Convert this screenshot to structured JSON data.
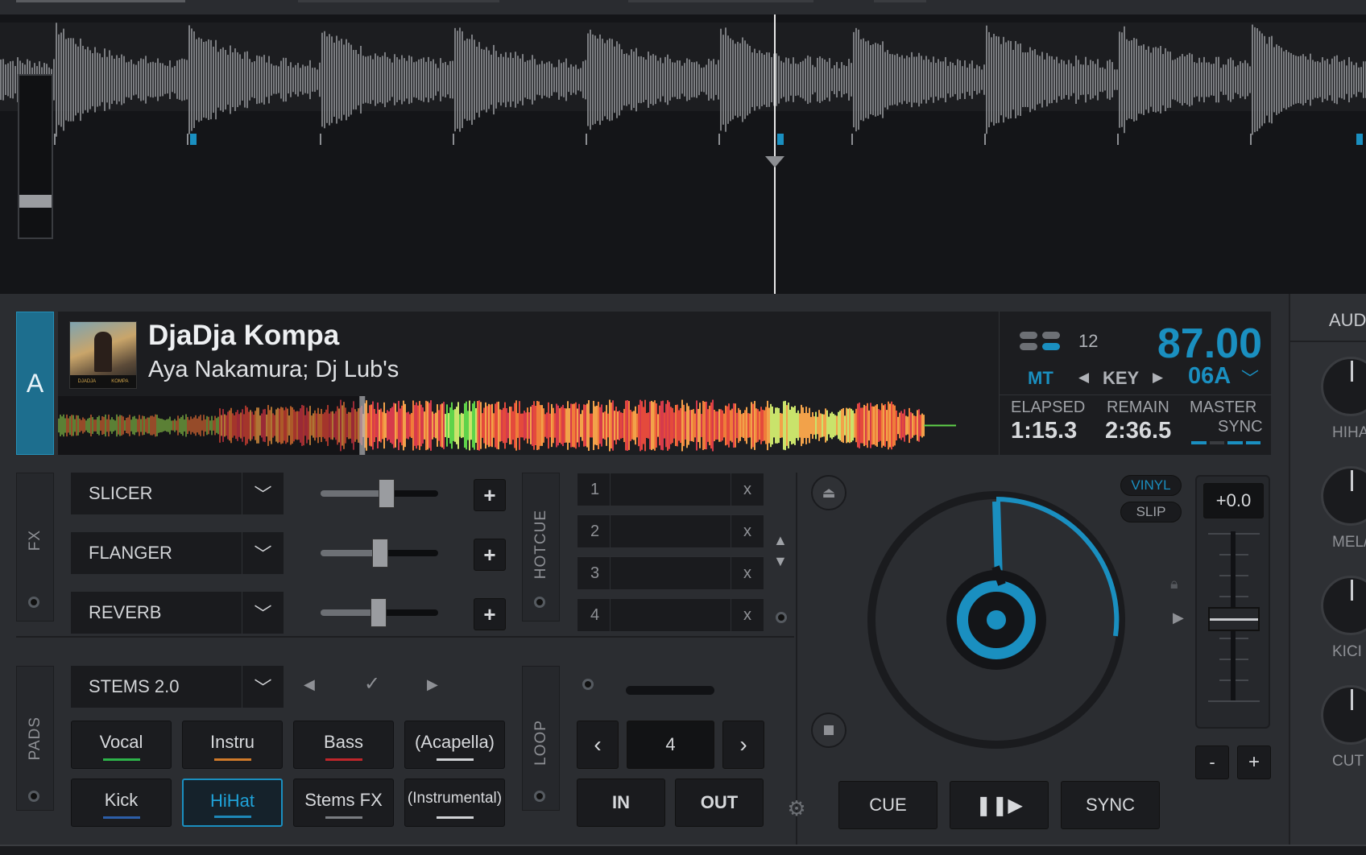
{
  "deck": {
    "letter": "A",
    "track_title": "DjaDja Kompa",
    "track_artist": "Aya Nakamura; Dj Lub's",
    "cover_caption_left": "DJADJA",
    "cover_caption_right": "KOMPA",
    "bpm": "87.00",
    "beat_count": "12",
    "mt_label": "MT",
    "key_label": "KEY",
    "key_value": "06A",
    "elapsed_label": "ELAPSED",
    "elapsed_value": "1:15.3",
    "remain_label": "REMAIN",
    "remain_value": "2:36.5",
    "master_label": "MASTER",
    "sync_label": "SYNC",
    "playhead_progress": 0.323
  },
  "fx": {
    "label": "FX",
    "slots": [
      {
        "name": "SLICER",
        "amount": 0.56
      },
      {
        "name": "FLANGER",
        "amount": 0.51
      },
      {
        "name": "REVERB",
        "amount": 0.49
      }
    ],
    "add_symbol": "+"
  },
  "hotcue": {
    "label": "HOTCUE",
    "cues": [
      {
        "num": "1",
        "clear": "x"
      },
      {
        "num": "2",
        "clear": "x"
      },
      {
        "num": "3",
        "clear": "x"
      },
      {
        "num": "4",
        "clear": "x"
      }
    ]
  },
  "pads": {
    "label": "PADS",
    "mode": "STEMS 2.0",
    "items": [
      {
        "label": "Vocal",
        "color": "#2db34a"
      },
      {
        "label": "Instru",
        "color": "#d07a2a"
      },
      {
        "label": "Bass",
        "color": "#c0262b"
      },
      {
        "label": "(Acapella)",
        "color": "#d0d2d5"
      },
      {
        "label": "Kick",
        "color": "#2c5ea8"
      },
      {
        "label": "HiHat",
        "color": "#1e88b8"
      },
      {
        "label": "Stems FX",
        "color": "#7a7d82"
      },
      {
        "label": "(Instrumental)",
        "color": "#d0d2d5"
      }
    ]
  },
  "loop": {
    "label": "LOOP",
    "size": "4",
    "in_label": "IN",
    "out_label": "OUT"
  },
  "jog": {
    "vinyl_label": "VINYL",
    "slip_label": "SLIP",
    "pitch_value": "+0.0",
    "pitch_minus": "-",
    "pitch_plus": "+"
  },
  "transport": {
    "cue_label": "CUE",
    "sync_label": "SYNC"
  },
  "side": {
    "header": "AUD",
    "knobs": [
      "HIHA",
      "MEL/V",
      "KICI",
      "CUT"
    ]
  },
  "colors": {
    "accent": "#1a8fc0",
    "deck_letter_bg": "#1d6e8e"
  }
}
